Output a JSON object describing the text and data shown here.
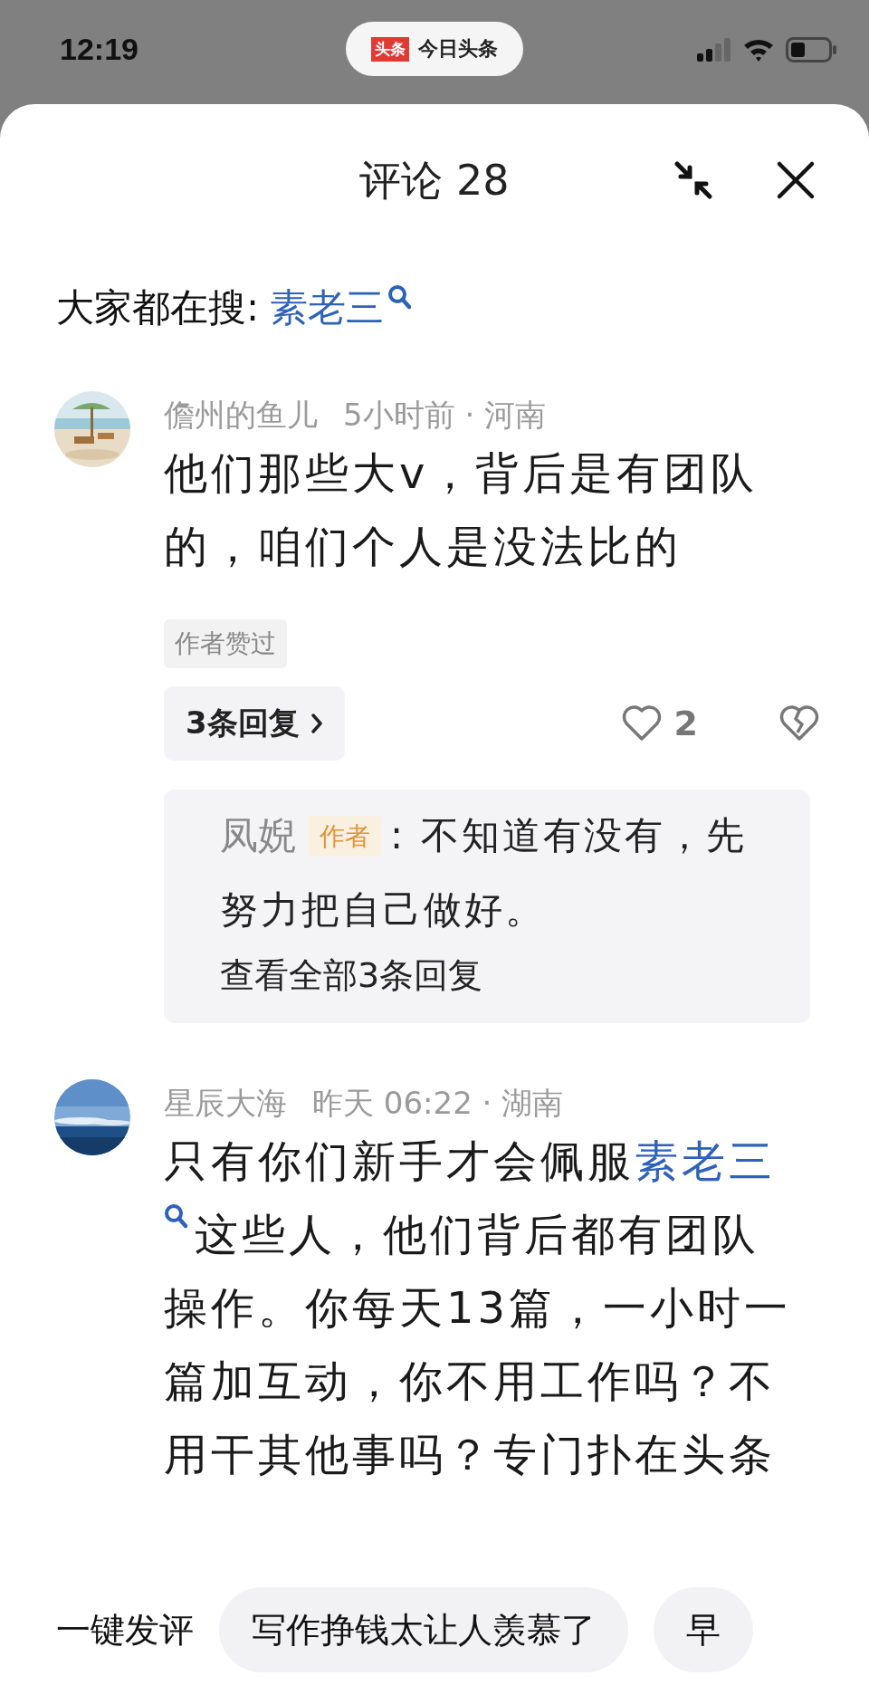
{
  "status_bar": {
    "time": "12:19",
    "app_badge": "头条",
    "app_name": "今日头条"
  },
  "header": {
    "title": "评论 28"
  },
  "trending": {
    "label": "大家都在搜:",
    "term": "素老三"
  },
  "comments": [
    {
      "user": "儋州的鱼儿",
      "meta": "5小时前 · 河南",
      "body": [
        {
          "kind": "text",
          "text": "他们那些大v，背后是有团队的，咱们个人是没法比的"
        }
      ],
      "author_liked": "作者赞过",
      "replies_button": "3条回复",
      "likes": "2",
      "reply_preview": {
        "user": "凤婗",
        "tag": "作者",
        "text": ": 不知道有没有，先努力把自己做好。",
        "view_all": "查看全部3条回复"
      }
    },
    {
      "user": "星辰大海",
      "meta": "昨天 06:22 · 湖南",
      "body": [
        {
          "kind": "text",
          "text": "只有你们新手才会佩服"
        },
        {
          "kind": "search_link",
          "text": "素老三"
        },
        {
          "kind": "text",
          "text": "这些人，他们背后都有团队操作。你每天13篇，一小时一篇加互动，你不用工作吗？不用干其他事吗？专门扑在头条"
        }
      ]
    }
  ],
  "quick_comment": {
    "label": "一键发评",
    "chips": [
      "写作挣钱太让人羡慕了",
      "早"
    ]
  }
}
